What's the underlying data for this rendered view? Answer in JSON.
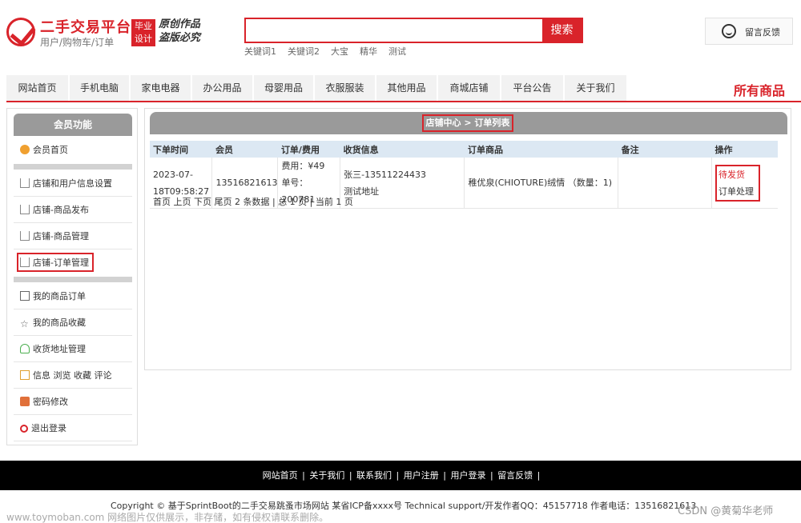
{
  "header": {
    "logo_title": "二手交易平台",
    "logo_subtitle": "用户/购物车/订单",
    "badge_line1": "毕业",
    "badge_line2": "设计",
    "slogan_line1": "原创作品",
    "slogan_line2": "盗版必究",
    "search_placeholder": "",
    "search_button": "搜索",
    "keywords": [
      "关键词1",
      "关键词2",
      "大宝",
      "精华",
      "测试"
    ],
    "feedback_label": "留言反馈"
  },
  "nav": {
    "items": [
      "网站首页",
      "手机电脑",
      "家电电器",
      "办公用品",
      "母婴用品",
      "衣服服装",
      "其他用品",
      "商城店铺",
      "平台公告",
      "关于我们"
    ],
    "all_goods": "所有商品"
  },
  "sidebar": {
    "title": "会员功能",
    "items": [
      "会员首页",
      "店铺和用户信息设置",
      "店铺-商品发布",
      "店铺-商品管理",
      "店铺-订单管理",
      "我的商品订单",
      "我的商品收藏",
      "收货地址管理",
      "信息 浏览 收藏 评论",
      "密码修改",
      "退出登录"
    ]
  },
  "main": {
    "panel_title": "店铺中心 > 订单列表",
    "columns": [
      "下单时间",
      "会员",
      "订单/费用",
      "收货信息",
      "订单商品",
      "备注",
      "操作"
    ],
    "rows": [
      {
        "time_line1": "2023-07-",
        "time_line2": "18T09:58:27",
        "member": "13516821613",
        "fee": "费用：¥49",
        "order_no": "单号：200781",
        "receiver": "张三-13511224433",
        "address": "测试地址",
        "goods": "稚优泉(CHIOTURE)绒情 （数量：1)",
        "remark": "",
        "status": "待发货",
        "action": "订单处理"
      }
    ],
    "pager": "首页 上页 下页 尾页 2 条数据 | 总 1 页 | 当前 1 页"
  },
  "footer": {
    "links": [
      "网站首页",
      "关于我们",
      "联系我们",
      "用户注册",
      "用户登录",
      "留言反馈"
    ],
    "copyright": "Copyright © 基于SprintBoot的二手交易跳蚤市场网站  某省ICP备xxxx号  Technical support/开发作者QQ：45157718  作者电话：13516821613"
  },
  "watermarks": {
    "left": "www.toymoban.com 网络图片仅供展示，非存储，如有侵权请联系删除。",
    "right": "CSDN @黄菊华老师"
  },
  "colors": {
    "brand_red": "#d9232a",
    "panel_grey": "#9a9a9a",
    "table_header": "#dce8f3"
  }
}
